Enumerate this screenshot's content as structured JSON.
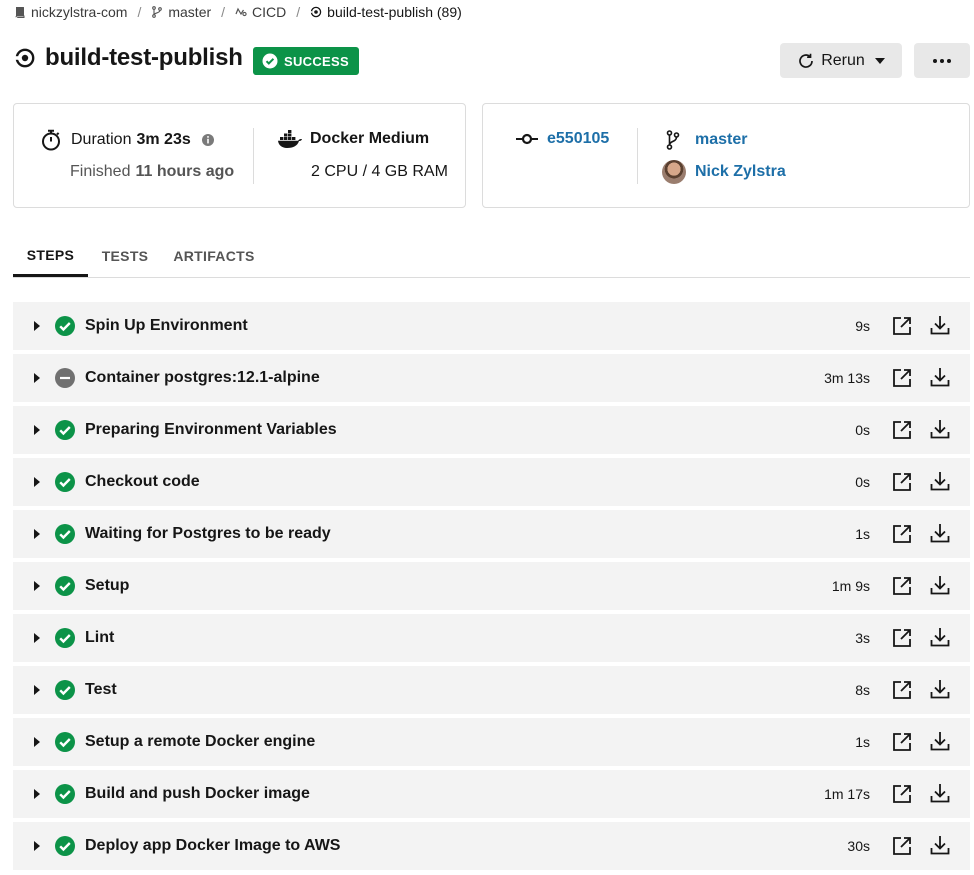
{
  "breadcrumb": {
    "org": "nickzylstra-com",
    "branch": "master",
    "project": "CICD",
    "job": "build-test-publish (89)"
  },
  "header": {
    "title": "build-test-publish",
    "status": "SUCCESS",
    "status_color": "#0c9348",
    "rerun_label": "Rerun"
  },
  "summary": {
    "duration_label": "Duration",
    "duration_value": "3m 23s",
    "finished_label": "Finished",
    "finished_value": "11 hours ago",
    "executor_name": "Docker Medium",
    "executor_spec": "2 CPU / 4 GB RAM",
    "commit": "e550105",
    "branch": "master",
    "author": "Nick Zylstra"
  },
  "tabs": [
    {
      "label": "STEPS",
      "active": true
    },
    {
      "label": "TESTS",
      "active": false
    },
    {
      "label": "ARTIFACTS",
      "active": false
    }
  ],
  "steps": [
    {
      "name": "Spin Up Environment",
      "duration": "9s",
      "status": "success"
    },
    {
      "name": "Container postgres:12.1-alpine",
      "duration": "3m 13s",
      "status": "neutral"
    },
    {
      "name": "Preparing Environment Variables",
      "duration": "0s",
      "status": "success"
    },
    {
      "name": "Checkout code",
      "duration": "0s",
      "status": "success"
    },
    {
      "name": "Waiting for Postgres to be ready",
      "duration": "1s",
      "status": "success"
    },
    {
      "name": "Setup",
      "duration": "1m 9s",
      "status": "success"
    },
    {
      "name": "Lint",
      "duration": "3s",
      "status": "success"
    },
    {
      "name": "Test",
      "duration": "8s",
      "status": "success"
    },
    {
      "name": "Setup a remote Docker engine",
      "duration": "1s",
      "status": "success"
    },
    {
      "name": "Build and push Docker image",
      "duration": "1m 17s",
      "status": "success"
    },
    {
      "name": "Deploy app Docker Image to AWS",
      "duration": "30s",
      "status": "success"
    }
  ],
  "colors": {
    "success": "#0c9348",
    "neutral": "#707070",
    "link": "#1d6fa8"
  }
}
